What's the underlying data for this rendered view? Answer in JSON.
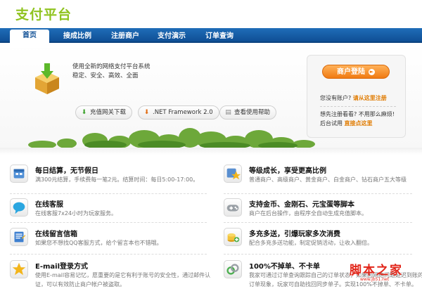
{
  "header": {
    "logo_text": "支付平台"
  },
  "nav": {
    "tabs": [
      {
        "label": "首页",
        "active": true
      },
      {
        "label": "接成比例",
        "active": false
      },
      {
        "label": "注册商户",
        "active": false
      },
      {
        "label": "支付演示",
        "active": false
      },
      {
        "label": "订单查询",
        "active": false
      }
    ]
  },
  "intro": {
    "line1": "使用全新的网络支付平台系统",
    "line2": "稳定、安全、高效、全面",
    "icon": "box-download-icon"
  },
  "downloads": [
    {
      "label": "充值网关下载",
      "icon": "green-down-arrow-icon"
    },
    {
      "label": ".NET Framework 2.0",
      "icon": "orange-down-arrow-icon"
    },
    {
      "label": "查看使用帮助",
      "icon": "help-doc-icon"
    }
  ],
  "login": {
    "button_label": "商户登陆",
    "no_account": "您没有账户?",
    "register_link": "请从这里注册",
    "trial_q": "想先注册看看? 不用那么麻烦!",
    "trial_prefix": "后台试用",
    "trial_link": "直接点这里"
  },
  "features": [
    {
      "title": "每日结算，无节假日",
      "desc": "满300元结算，手续费每一笔2元。结算时间：每日5:00-17:00。",
      "icon": "calendar-icon"
    },
    {
      "title": "等级成长，享受更高比例",
      "desc": "普通商户、高级商户、黄金商户、白金商户、钻石商户五大等级",
      "icon": "level-star-icon"
    },
    {
      "title": "在线客服",
      "desc": "在线客服7x24小时为玩家服务。",
      "icon": "chat-bubble-icon"
    },
    {
      "title": "支持金币、金刚石、元宝蛋等脚本",
      "desc": "商户在后台操作，由程序全自动生成充值脚本。",
      "icon": "gamepad-icon"
    },
    {
      "title": "在线留言信箱",
      "desc": "如果您不想找QQ客服方式，给个留言本也不错哦。",
      "icon": "notepad-icon"
    },
    {
      "title": "多充多送，引爆玩家多次消费",
      "desc": "配合多充多送功能，制定促销活动，让收入翻倍。",
      "icon": "coins-icon"
    },
    {
      "title": "E-mail登录方式",
      "desc": "使用E-mail容易记忆，愿重要的是它有利于账号的安全性，通过邮件认证，可以有效防止商户帐户被盗取。",
      "icon": "star-icon"
    },
    {
      "title": "100%不掉单、不卡单",
      "desc": "我家可通过订单查询跟踪自己的订单状态，如果因网络问题延迟到账的订单现象，玩家可自助找回同步单子。实现100%不掉单、不卡单。",
      "icon": "link-arrow-icon"
    }
  ],
  "watermark": {
    "text": "脚本之家",
    "sub": "www.jb51.net"
  },
  "colors": {
    "brand_green": "#8fc31f",
    "nav_blue": "#0f4f95",
    "orange": "#f07a12"
  }
}
